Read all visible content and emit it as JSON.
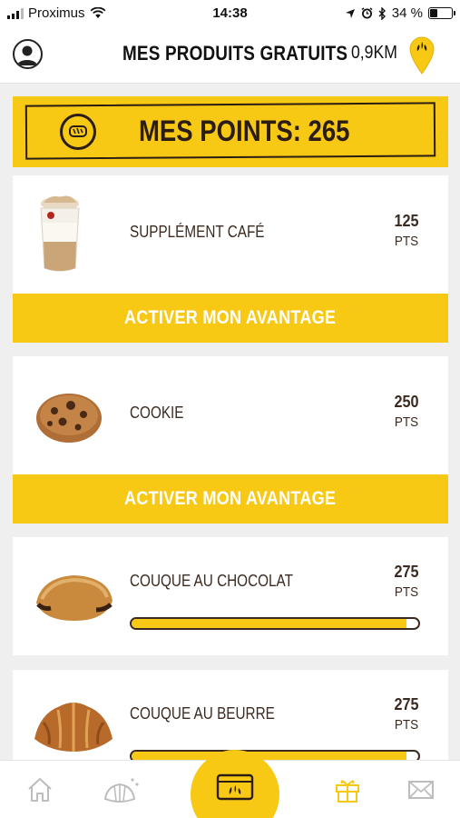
{
  "status_bar": {
    "carrier": "Proximus",
    "time": "14:38",
    "battery": "34 %",
    "battery_level": 0.34
  },
  "header": {
    "title": "MES PRODUITS GRATUITS",
    "distance": "0,9KM",
    "icons": [
      "user-avatar-icon",
      "location-pin-icon"
    ]
  },
  "points": {
    "label": "MES POINTS: 265",
    "icon": "bread-coin-icon"
  },
  "products": [
    {
      "name": "SUPPLÉMENT CAFÉ",
      "points": "125",
      "unit": "PTS",
      "cta": "ACTIVER MON AVANTAGE",
      "image": "latte-glass"
    },
    {
      "name": "COOKIE",
      "points": "250",
      "unit": "PTS",
      "cta": "ACTIVER MON AVANTAGE",
      "image": "cookie"
    },
    {
      "name": "COUQUE AU CHOCOLAT",
      "points": "275",
      "unit": "PTS",
      "progress": 0.96,
      "image": "pain-au-chocolat"
    },
    {
      "name": "COUQUE AU BEURRE",
      "points": "275",
      "unit": "PTS",
      "progress": 0.96,
      "image": "croissant"
    }
  ],
  "tab_bar": {
    "tabs": [
      "home-icon",
      "pastries-icon",
      "loyalty-card-icon",
      "gift-icon",
      "mail-icon"
    ],
    "active": "loyalty-card-icon",
    "accent": "#f7c915"
  },
  "colors": {
    "accent_yellow": "#f7c915",
    "text_brown": "#3b2a20",
    "background": "#efefef"
  }
}
